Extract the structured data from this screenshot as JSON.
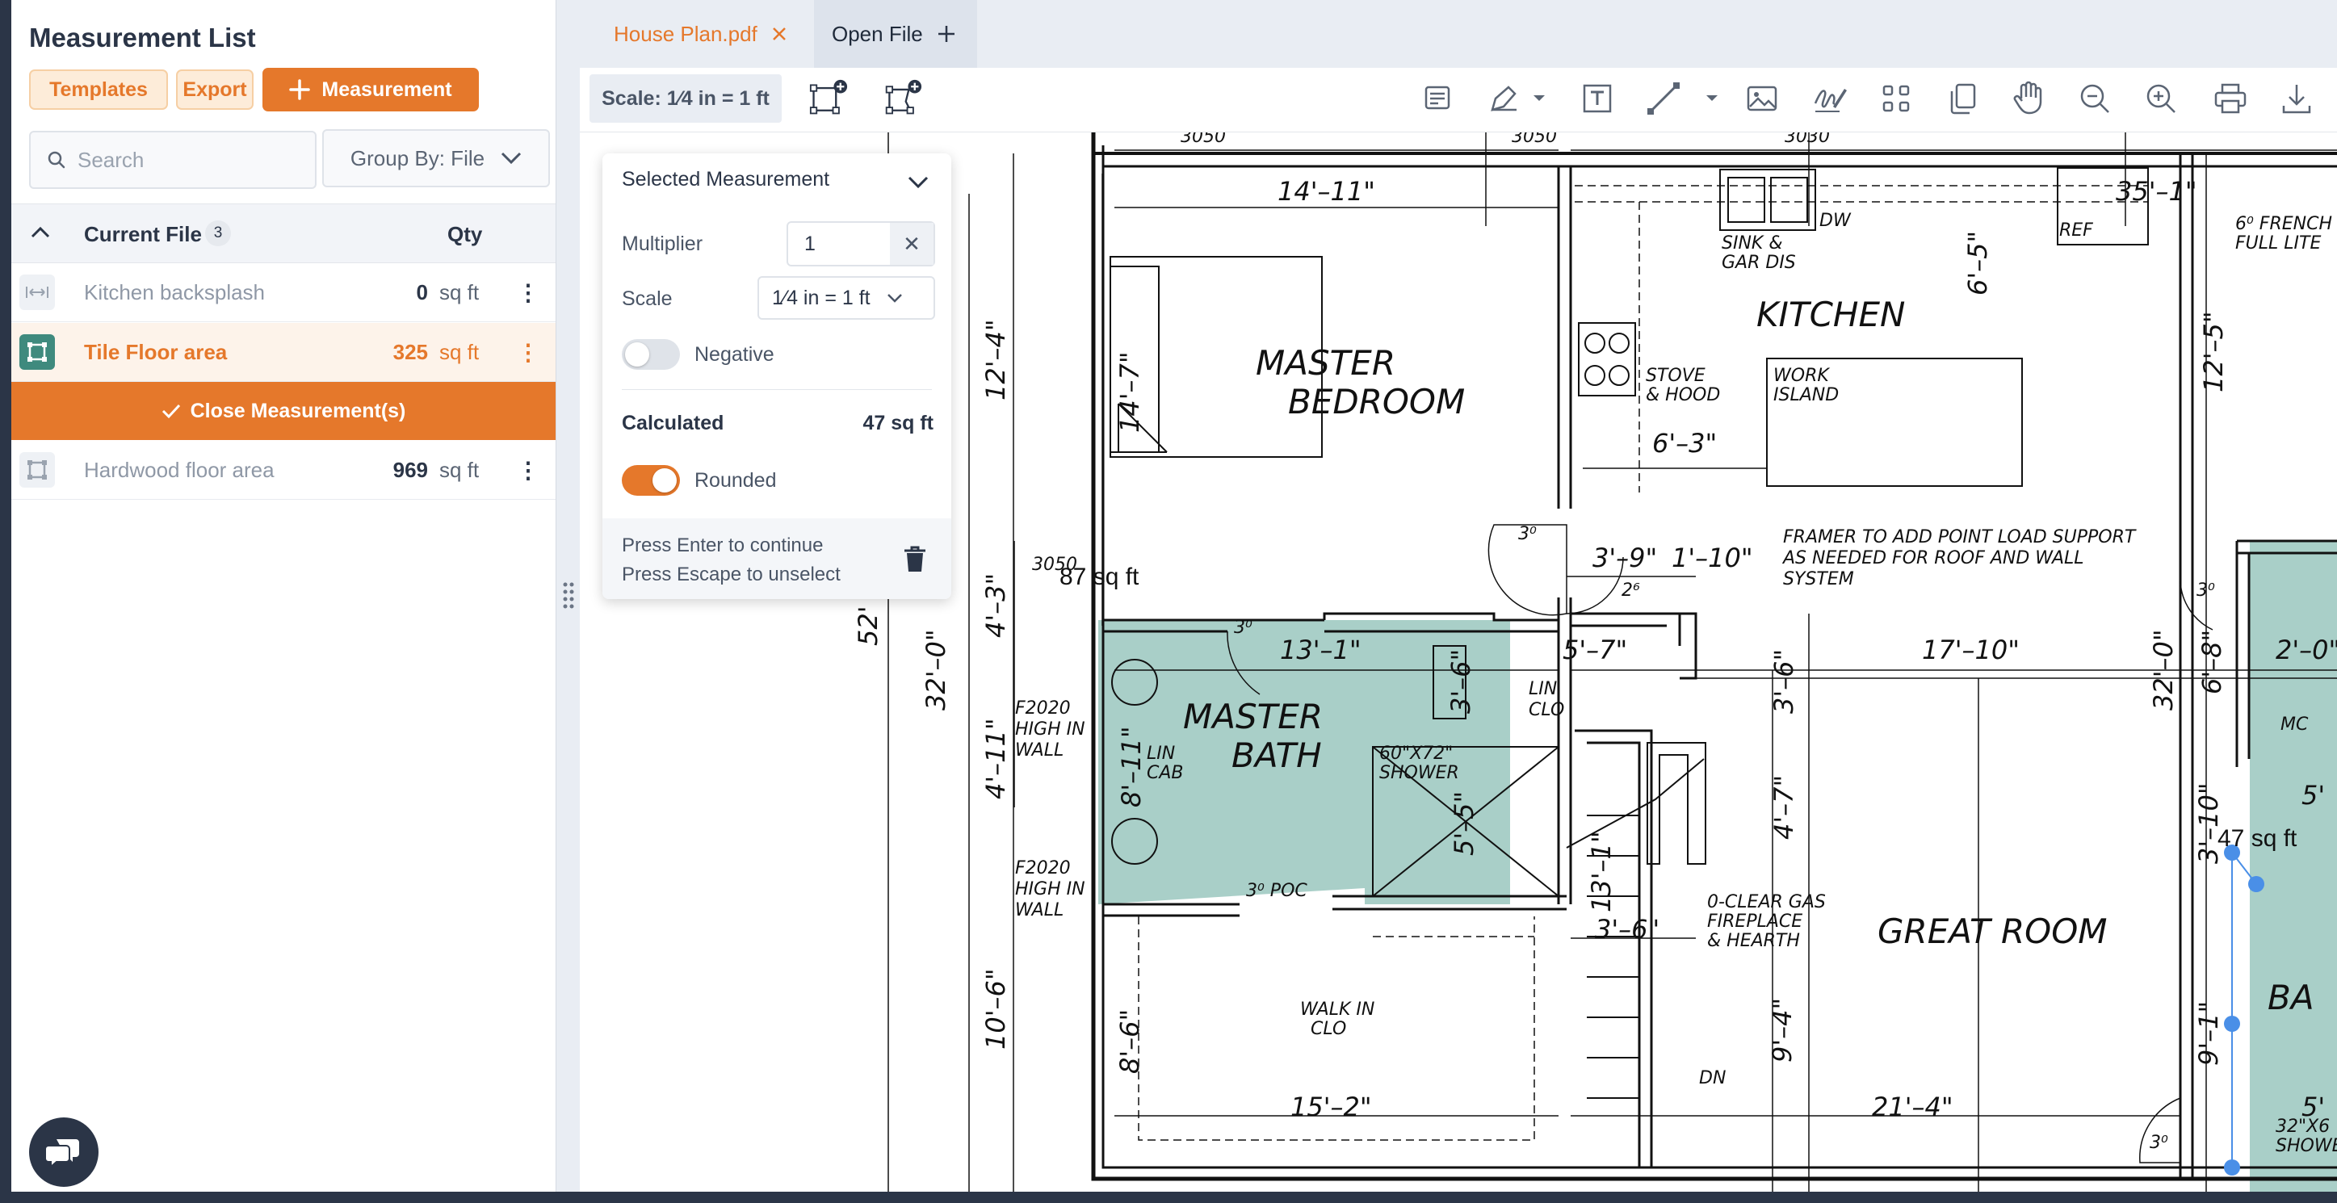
{
  "sidebar": {
    "title": "Measurement List",
    "templates_label": "Templates",
    "export_label": "Export",
    "add_measurement_label": "Measurement",
    "search_placeholder": "Search",
    "group_by_label": "Group By: File",
    "table": {
      "current_file_label": "Current File",
      "count": "3",
      "qty_label": "Qty"
    },
    "items": [
      {
        "name": "Kitchen backsplash",
        "value": "0",
        "unit": "sq ft",
        "active": false
      },
      {
        "name": "Tile Floor area",
        "value": "325",
        "unit": "sq ft",
        "active": true
      },
      {
        "name": "Hardwood floor area",
        "value": "969",
        "unit": "sq ft",
        "active": false
      }
    ],
    "close_label": "Close Measurement(s)"
  },
  "tabs": {
    "file_tab": "House Plan.pdf",
    "open_file": "Open File"
  },
  "toolbar": {
    "scale": "Scale: 1⁄4 in = 1 ft",
    "icons": [
      "add-area-icon",
      "add-polygon-icon",
      "note-icon",
      "pen-icon",
      "text-box-icon",
      "line-icon",
      "image-icon",
      "signature-icon",
      "grid-icon",
      "copy-pages-icon",
      "hand-icon",
      "zoom-out-icon",
      "zoom-in-icon",
      "print-icon",
      "download-icon"
    ]
  },
  "selected_panel": {
    "title": "Selected Measurement",
    "multiplier_label": "Multiplier",
    "multiplier_value": "1",
    "scale_label": "Scale",
    "scale_value": "1⁄4 in = 1 ft",
    "negative_label": "Negative",
    "calculated_label": "Calculated",
    "calculated_value": "47 sq ft",
    "rounded_label": "Rounded",
    "hint_enter": "Press Enter to continue",
    "hint_escape": "Press Escape to unselect"
  },
  "plan": {
    "labels": {
      "master_bedroom_1": "MASTER",
      "master_bedroom_2": "BEDROOM",
      "kitchen": "KITCHEN",
      "master_bath_1": "MASTER",
      "master_bath_2": "BATH",
      "great_room": "GREAT ROOM",
      "walk_in_clo": "WALK IN",
      "walk_in_clo2": "CLO",
      "sink": "SINK &",
      "sink2": "GAR DIS",
      "dw": "DW",
      "ref": "REF",
      "stove": "STOVE",
      "stove2": "& HOOD",
      "work_island": "WORK",
      "work_island2": "ISLAND",
      "framer1": "FRAMER TO ADD POINT LOAD SUPPORT",
      "framer2": "AS NEEDED FOR ROOF AND WALL",
      "framer3": "SYSTEM",
      "lin_clo": "LIN",
      "lin_clo2": "CLO",
      "lin_cab": "LIN",
      "lin_cab2": "CAB",
      "shower": "60\"X72\"",
      "shower2": "SHOWER",
      "poc": "3⁰ POC",
      "fireplace1": "0-CLEAR GAS",
      "fireplace2": "FIREPLACE",
      "fireplace3": "& HEARTH",
      "f2020a": "F2020",
      "f2020a2": "HIGH IN",
      "f2020a3": "WALL",
      "f2020b": "F2020",
      "f2020b2": "HIGH IN",
      "f2020b3": "WALL",
      "dn": "DN",
      "mc": "MC",
      "french": "6⁰ FRENCH",
      "french2": "FULL LITE",
      "ba": "BA",
      "x32": "32\"X6",
      "showe": "SHOWE",
      "d3050a": "3050",
      "d3050b": "3050",
      "d3030": "3030",
      "d3050c": "3050"
    },
    "dims": {
      "d1": "14'–11\"",
      "d2": "35'–1\"",
      "d3": "6'–5\"",
      "d4": "12'–4\"",
      "d5": "14'–7\"",
      "d6": "6'–3\"",
      "d7": "12'–5\"",
      "d8": "3'–9\"",
      "d9": "1'–10\"",
      "d10": "13'–1\"",
      "d11": "5'–7\"",
      "d12": "17'–10\"",
      "d13": "32'–0\"",
      "d14": "32'–0\"",
      "d15": "4'–3\"",
      "d16": "4'–11\"",
      "d17": "8'–11\"",
      "d18": "3'–6\"",
      "d19": "3'–6\"",
      "d20": "5'–5\"",
      "d21": "4'–7\"",
      "d22": "13'–1\"",
      "d23": "3'–6\"",
      "d24": "10'–6\"",
      "d25": "8'–6\"",
      "d26": "15'–2\"",
      "d27": "21'–4\"",
      "d28": "9'–4\"",
      "d29": "9'–1\"",
      "d30": "3'–10\"",
      "d31": "6'–8\"",
      "d32": "2'–0\"",
      "d33": "52'",
      "d34": "5'",
      "d35": "5'",
      "deg1": "3⁰",
      "deg2": "3⁰",
      "deg3": "2⁶",
      "deg4": "3⁰",
      "deg5": "3⁰",
      "d3050d": "3050"
    },
    "area_87": "87 sq ft",
    "area_47": "47 sq ft"
  },
  "colors": {
    "accent": "#e5782b",
    "dark": "#2b3547",
    "selected_area": "#a9cfc8",
    "handle": "#4a8fe7"
  }
}
